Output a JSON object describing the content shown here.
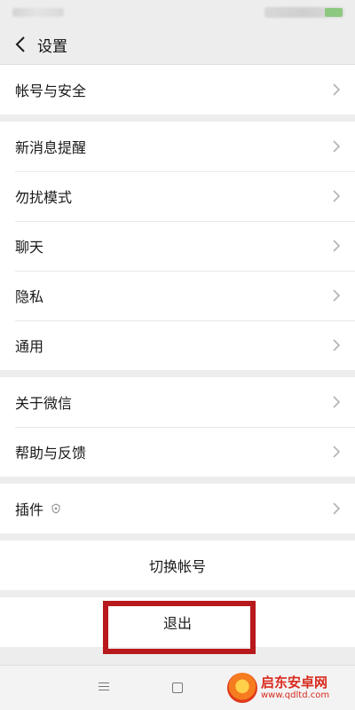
{
  "nav": {
    "title": "设置"
  },
  "sections": {
    "account": [
      {
        "label": "帐号与安全"
      }
    ],
    "main": [
      {
        "label": "新消息提醒"
      },
      {
        "label": "勿扰模式"
      },
      {
        "label": "聊天"
      },
      {
        "label": "隐私"
      },
      {
        "label": "通用"
      }
    ],
    "about": [
      {
        "label": "关于微信"
      },
      {
        "label": "帮助与反馈"
      }
    ],
    "plugins": [
      {
        "label": "插件"
      }
    ]
  },
  "actions": {
    "switch_account": "切换帐号",
    "logout": "退出"
  },
  "watermark": {
    "name": "启东安卓网",
    "url": "www.qdltd.com"
  },
  "colors": {
    "highlight": "#b8191c",
    "background": "#ededed"
  }
}
